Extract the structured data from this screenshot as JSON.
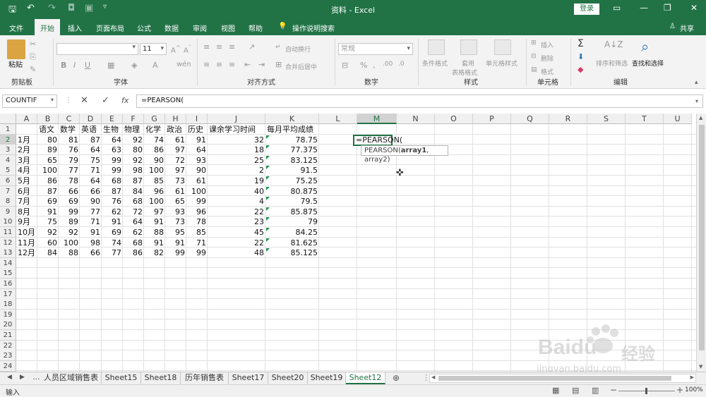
{
  "app": {
    "title": "资料 - Excel",
    "login": "登录"
  },
  "tabs": [
    "文件",
    "开始",
    "插入",
    "页面布局",
    "公式",
    "数据",
    "审阅",
    "视图",
    "帮助",
    "操作说明搜索"
  ],
  "share": "共享",
  "ribbon": {
    "paste": "粘贴",
    "clipboard": "剪贴板",
    "font_size": "11",
    "font_group": "字体",
    "wrap_text": "自动换行",
    "merge_center": "合并后居中",
    "alignment": "对齐方式",
    "number_format": "常规",
    "number_group": "数字",
    "cond_format": "条件格式",
    "table_format_1": "套用",
    "table_format_2": "表格格式",
    "cell_styles": "单元格样式",
    "styles_group": "样式",
    "insert": "插入",
    "delete": "删除",
    "format": "格式",
    "cells_group": "单元格",
    "sort_filter": "排序和筛选",
    "find_select": "查找和选择",
    "editing_group": "编辑"
  },
  "formula_bar": {
    "name_box": "COUNTIF",
    "fx": "fx",
    "formula": "=PEARSON("
  },
  "columns": [
    "A",
    "B",
    "C",
    "D",
    "E",
    "F",
    "G",
    "H",
    "I",
    "J",
    "K",
    "L",
    "M",
    "N",
    "O",
    "P",
    "Q",
    "R",
    "S",
    "T",
    "U"
  ],
  "headers_row1": [
    "",
    "语文",
    "数学",
    "英语",
    "生物",
    "物理",
    "化学",
    "政治",
    "历史",
    "课余学习时间",
    "每月平均成绩"
  ],
  "rows": [
    [
      "1月",
      "80",
      "81",
      "87",
      "64",
      "92",
      "74",
      "61",
      "91",
      "32",
      "78.75"
    ],
    [
      "2月",
      "89",
      "76",
      "64",
      "63",
      "80",
      "86",
      "97",
      "64",
      "18",
      "77.375"
    ],
    [
      "3月",
      "65",
      "79",
      "75",
      "99",
      "92",
      "90",
      "72",
      "93",
      "25",
      "83.125"
    ],
    [
      "4月",
      "100",
      "77",
      "71",
      "99",
      "98",
      "100",
      "97",
      "90",
      "2",
      "91.5"
    ],
    [
      "5月",
      "86",
      "78",
      "64",
      "68",
      "87",
      "85",
      "73",
      "61",
      "19",
      "75.25"
    ],
    [
      "6月",
      "87",
      "66",
      "66",
      "87",
      "84",
      "96",
      "61",
      "100",
      "40",
      "80.875"
    ],
    [
      "7月",
      "69",
      "69",
      "90",
      "76",
      "68",
      "100",
      "65",
      "99",
      "4",
      "79.5"
    ],
    [
      "8月",
      "91",
      "99",
      "77",
      "62",
      "72",
      "97",
      "93",
      "96",
      "22",
      "85.875"
    ],
    [
      "9月",
      "75",
      "89",
      "71",
      "91",
      "64",
      "91",
      "73",
      "78",
      "23",
      "79"
    ],
    [
      "10月",
      "92",
      "92",
      "91",
      "69",
      "62",
      "88",
      "95",
      "85",
      "45",
      "84.25"
    ],
    [
      "11月",
      "60",
      "100",
      "98",
      "74",
      "68",
      "91",
      "91",
      "71",
      "22",
      "81.625"
    ],
    [
      "12月",
      "84",
      "88",
      "66",
      "77",
      "86",
      "82",
      "99",
      "99",
      "48",
      "85.125"
    ]
  ],
  "active_cell": "=PEARSON(",
  "tooltip": {
    "fn": "PEARSON(",
    "arg1": "array1",
    "rest": ", array2)"
  },
  "sheets": [
    "人员区域销售表",
    "Sheet15",
    "Sheet18",
    "历年销售表",
    "Sheet17",
    "Sheet20",
    "Sheet19",
    "Sheet12"
  ],
  "active_sheet": "Sheet12",
  "status": {
    "mode": "输入",
    "zoom": "100%"
  },
  "watermark": {
    "brand": "Baidu",
    "cn": "经验",
    "url": "jingyan.baidu.com"
  }
}
